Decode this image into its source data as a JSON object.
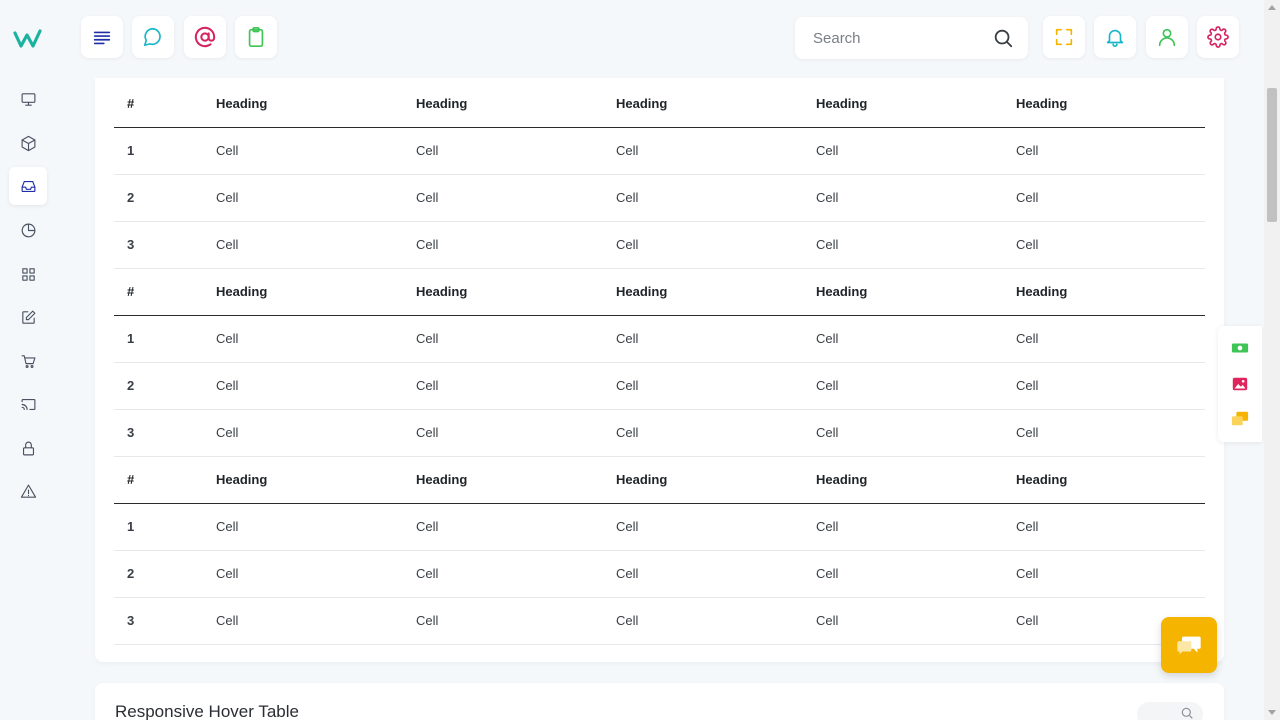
{
  "sidebar": {
    "icons": [
      "monitor-icon",
      "box-icon",
      "inbox-icon",
      "pie-chart-icon",
      "grid-icon",
      "edit-icon",
      "cart-icon",
      "cast-icon",
      "lock-icon",
      "alert-icon"
    ],
    "active_index": 2
  },
  "topbar": {
    "search_placeholder": "Search"
  },
  "table": {
    "groups": [
      {
        "header": [
          "#",
          "Heading",
          "Heading",
          "Heading",
          "Heading",
          "Heading"
        ],
        "rows": [
          [
            "1",
            "Cell",
            "Cell",
            "Cell",
            "Cell",
            "Cell"
          ],
          [
            "2",
            "Cell",
            "Cell",
            "Cell",
            "Cell",
            "Cell"
          ],
          [
            "3",
            "Cell",
            "Cell",
            "Cell",
            "Cell",
            "Cell"
          ]
        ]
      },
      {
        "header": [
          "#",
          "Heading",
          "Heading",
          "Heading",
          "Heading",
          "Heading"
        ],
        "rows": [
          [
            "1",
            "Cell",
            "Cell",
            "Cell",
            "Cell",
            "Cell"
          ],
          [
            "2",
            "Cell",
            "Cell",
            "Cell",
            "Cell",
            "Cell"
          ],
          [
            "3",
            "Cell",
            "Cell",
            "Cell",
            "Cell",
            "Cell"
          ]
        ]
      },
      {
        "header": [
          "#",
          "Heading",
          "Heading",
          "Heading",
          "Heading",
          "Heading"
        ],
        "rows": [
          [
            "1",
            "Cell",
            "Cell",
            "Cell",
            "Cell",
            "Cell"
          ],
          [
            "2",
            "Cell",
            "Cell",
            "Cell",
            "Cell",
            "Cell"
          ],
          [
            "3",
            "Cell",
            "Cell",
            "Cell",
            "Cell",
            "Cell"
          ]
        ]
      }
    ]
  },
  "next_section": {
    "title": "Responsive Hover Table"
  },
  "colors": {
    "brand": "#1bb3a0",
    "menu": "#1f2fa6",
    "chat": "#17b7c9",
    "at": "#d6245e",
    "clipboard": "#3fc456",
    "fullscreen": "#f5b400",
    "bell": "#17b7c9",
    "user": "#3fc456",
    "settings": "#d6245e",
    "chat_button": "#f5b400"
  }
}
